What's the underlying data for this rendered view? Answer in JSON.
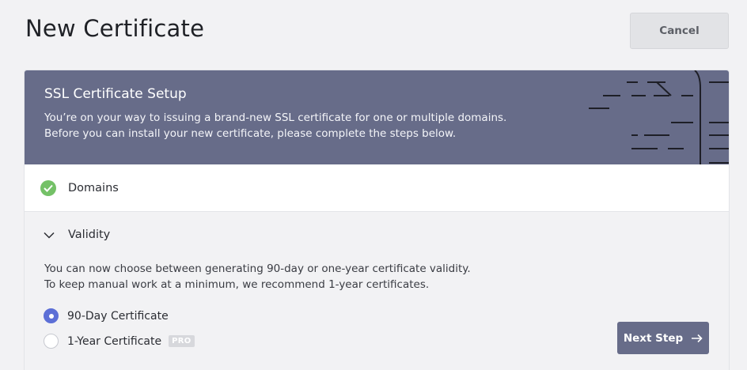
{
  "header": {
    "title": "New Certificate",
    "cancel_label": "Cancel"
  },
  "banner": {
    "title": "SSL Certificate Setup",
    "line1": "You’re on your way to issuing a brand-new SSL certificate for one or multiple domains.",
    "line2": "Before you can install your new certificate, please complete the steps below."
  },
  "steps": {
    "domains": {
      "label": "Domains",
      "icon": "check-circle-icon",
      "status": "completed"
    },
    "validity": {
      "label": "Validity",
      "icon": "chevron-down-icon",
      "desc1": "You can now choose between generating 90-day or one-year certificate validity.",
      "desc2": "To keep manual work at a minimum, we recommend 1-year certificates.",
      "options": [
        {
          "label": "90-Day Certificate",
          "selected": true
        },
        {
          "label": "1-Year Certificate",
          "selected": false,
          "badge": "PRO"
        }
      ]
    }
  },
  "actions": {
    "next_label": "Next Step",
    "next_icon": "arrow-right-icon"
  },
  "colors": {
    "banner": "#676c89",
    "success": "#74c167",
    "radio_selected": "#5c6fd6",
    "cancel_bg": "#e2e3e6"
  }
}
